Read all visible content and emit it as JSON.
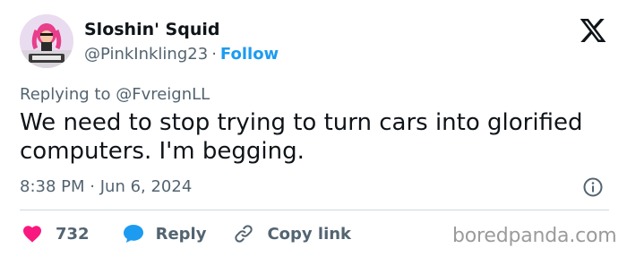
{
  "author": {
    "display_name": "Sloshin' Squid",
    "handle": "@PinkInkling23",
    "separator": "·",
    "follow_label": "Follow"
  },
  "reply_context": {
    "prefix": "Replying to",
    "mention": "@FvreignLL"
  },
  "tweet": {
    "text": "We need to stop trying to turn cars into glorified computers. I'm begging.",
    "time": "8:38 PM",
    "separator": "·",
    "date": "Jun 6, 2024"
  },
  "actions": {
    "like_count": "732",
    "reply_label": "Reply",
    "copy_link_label": "Copy link"
  },
  "watermark": "boredpanda.com",
  "colors": {
    "accent": "#1d9bf0",
    "like": "#f91880",
    "text": "#0f1419",
    "muted": "#536471"
  },
  "icons": [
    "x-logo-icon",
    "info-icon",
    "heart-icon",
    "reply-bubble-icon",
    "link-icon"
  ]
}
